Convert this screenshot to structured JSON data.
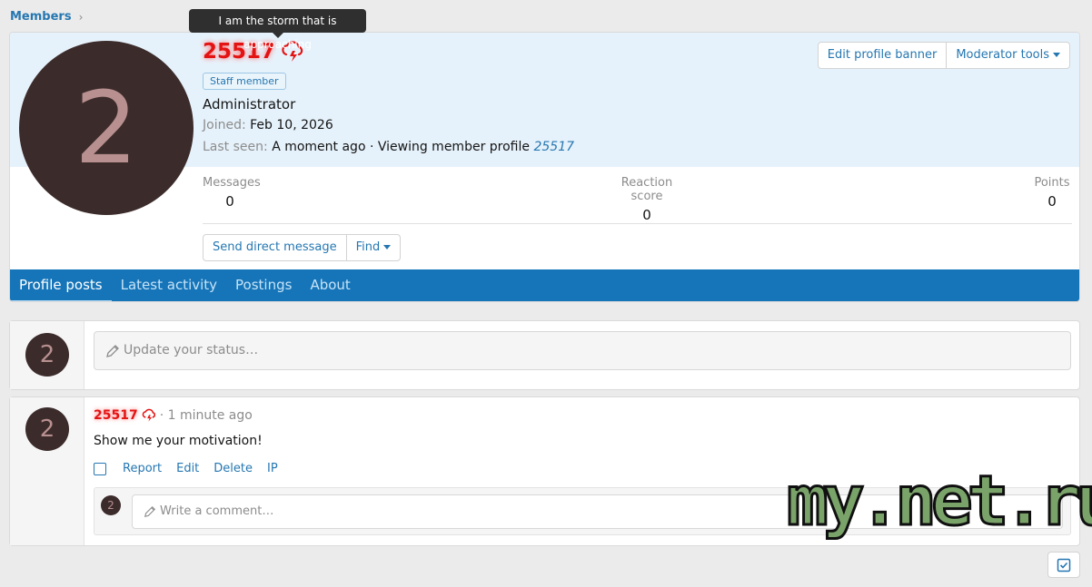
{
  "breadcrumb": {
    "label": "Members",
    "separator": "›"
  },
  "tooltip": {
    "text": "I am the storm that is approaching"
  },
  "profile": {
    "avatar_letter": "2",
    "username": "25517",
    "badge": "Staff member",
    "title": "Administrator",
    "joined_label": "Joined:",
    "joined_value": "Feb 10, 2026",
    "last_seen_label": "Last seen:",
    "last_seen_value": "A moment ago · Viewing member profile",
    "last_seen_link": "25517",
    "user_icon": "storm-cloud-icon"
  },
  "header_buttons": {
    "edit_banner": "Edit profile banner",
    "moderator_tools": "Moderator tools"
  },
  "stats": [
    {
      "label": "Messages",
      "value": "0"
    },
    {
      "label": "Reaction score",
      "value": "0"
    },
    {
      "label": "Points",
      "value": "0"
    }
  ],
  "actions": {
    "send_message": "Send direct message",
    "find": "Find"
  },
  "tabs": [
    "Profile posts",
    "Latest activity",
    "Postings",
    "About"
  ],
  "status": {
    "placeholder": "Update your status…"
  },
  "post": {
    "author": "25517",
    "time": "· 1 minute ago",
    "body": "Show me your motivation!",
    "links": [
      "Report",
      "Edit",
      "Delete",
      "IP"
    ],
    "comment_placeholder": "Write a comment…"
  },
  "watermark": "my.net.ru",
  "colors": {
    "accent": "#2577b1",
    "tab_bar": "#1675b9",
    "username": "#e41313",
    "banner": "#e6f2fb",
    "avatar_bg": "#3c2b2b"
  }
}
